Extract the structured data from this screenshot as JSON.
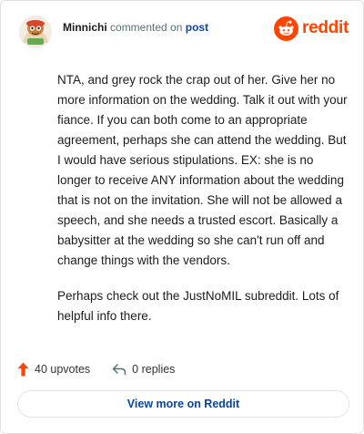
{
  "header": {
    "username": "Minnichi",
    "verb": "commented on",
    "target": "post",
    "brand_name": "reddit",
    "brand_color": "#ff4500"
  },
  "comment": {
    "paragraphs": [
      "NTA, and grey rock the crap out of her. Give her no more information on the wedding. Talk it out with your fiance. If you can both come to an appropriate agreement, perhaps she can attend the wedding. But I would have serious stipulations. EX: she is no longer to receive ANY information about the wedding that is not on the invitation. She will not be allowed a speech, and she needs a trusted escort. Basically a babysitter at the wedding so she can't run off and change things with the vendors.",
      "Perhaps check out the JustNoMIL subreddit. Lots of helpful info there."
    ]
  },
  "actions": {
    "upvotes_label": "40 upvotes",
    "replies_label": "0 replies",
    "upvote_color": "#ff4500"
  },
  "footer": {
    "view_more_label": "View more on Reddit"
  }
}
